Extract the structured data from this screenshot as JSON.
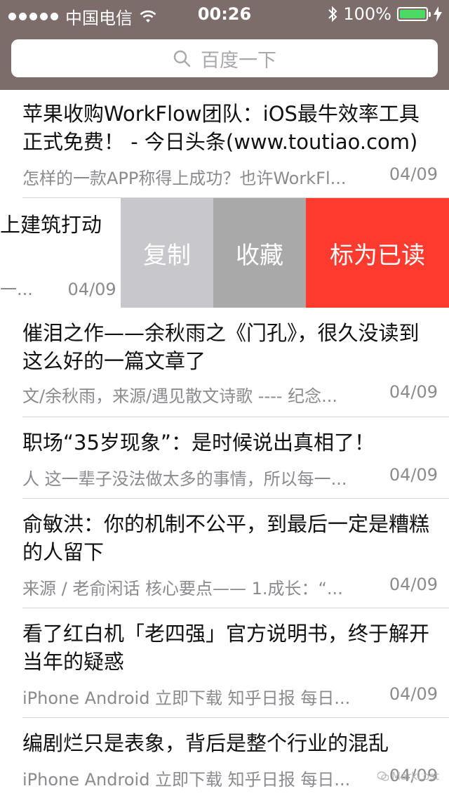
{
  "status_bar": {
    "carrier": "中国电信",
    "time": "00:26",
    "battery": "100%",
    "battery_level": 1.0
  },
  "search": {
    "placeholder": "百度一下"
  },
  "swiped_row": {
    "title_fragment": "上建筑打动",
    "snippet_fragment": "一...",
    "date": "04/09",
    "actions": [
      {
        "label": "复制",
        "color": "#c8c7cc"
      },
      {
        "label": "收藏",
        "color": "#a9a9a9"
      },
      {
        "label": "标为已读",
        "color": "#ff3b30"
      }
    ]
  },
  "articles": [
    {
      "title": "苹果收购WorkFlow团队：iOS最牛效率工具正式免费！ - 今日头条(www.toutiao.com)",
      "snippet": "怎样的一款APP称得上成功？也许WorkFl...",
      "date": "04/09"
    },
    {
      "title": "催泪之作——余秋雨之《门孔》，很久没读到这么好的一篇文章了",
      "snippet": "文/余秋雨，来源/遇见散文诗歌 ---- 纪念...",
      "date": "04/09"
    },
    {
      "title": "职场“35岁现象”：是时候说出真相了！",
      "snippet": "人 这一辈子没法做太多的事情，所以每一...",
      "date": "04/09"
    },
    {
      "title": "俞敏洪：你的机制不公平，到最后一定是糟糕的人留下",
      "snippet": "来源 / 老俞闲话 核心要点—— 1.成长：“...",
      "date": "04/09"
    },
    {
      "title": "看了红白机「老四强」官方说明书，终于解开当年的疑惑",
      "snippet": "iPhone   Android 立即下载 知乎日报 每日...",
      "date": "04/09"
    },
    {
      "title": "编剧烂只是表象，背后是整个行业的混乱",
      "snippet": "iPhone   Android 立即下载 知乎日报 每日...",
      "date": "04/09"
    }
  ],
  "watermark": "MarkLost",
  "colors": {
    "header_bg": "#7c6d6a",
    "battery_green": "#4cd964",
    "read_action": "#ff3b30"
  }
}
